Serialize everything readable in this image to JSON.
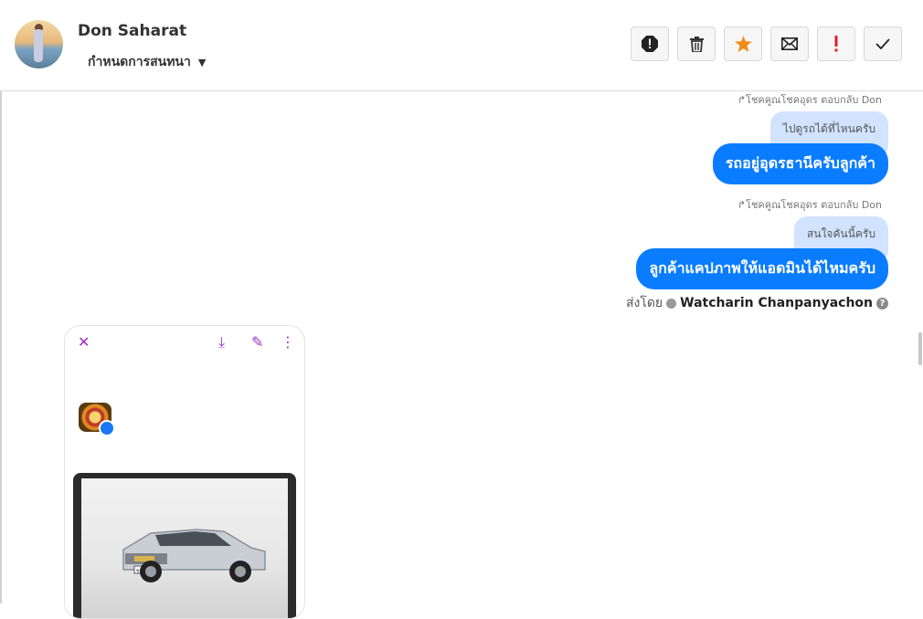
{
  "header": {
    "contact_name": "Don Saharat",
    "assign_label": "กำหนดการสนทนา",
    "toolbar": [
      {
        "name": "spam-button",
        "icon": "octagon-exclamation-icon"
      },
      {
        "name": "delete-button",
        "icon": "trash-icon"
      },
      {
        "name": "star-button",
        "icon": "star-icon",
        "color": "#f08c1a"
      },
      {
        "name": "mark-unread-button",
        "icon": "envelope-icon"
      },
      {
        "name": "follow-up-button",
        "icon": "exclamation-icon",
        "color": "#e02020"
      },
      {
        "name": "done-button",
        "icon": "check-icon"
      }
    ]
  },
  "messages": [
    {
      "reply_meta": "↱โชคคูณโชคอุดร ตอบกลับ Don",
      "quoted": "ไปดูรถได้ที่ไหนครับ",
      "text": "รถอยู่อุดรธานีครับลูกค้า"
    },
    {
      "reply_meta": "↱โชคคูณโชคอุดร ตอบกลับ Don",
      "quoted": "สนใจคันนี้ครับ",
      "text": "ลูกค้าแคปภาพให้แอดมินได้ไหมครับ"
    }
  ],
  "sent_by": {
    "label": "ส่งโดย",
    "name": "Watcharin Chanpanyachon",
    "help": "?"
  },
  "attachment": {
    "icons": [
      "close-icon",
      "download-icon",
      "edit-icon",
      "more-vertical-icon"
    ],
    "close": "✕",
    "download": "⤓",
    "edit": "✎",
    "more": "⋮",
    "plate_text": "ขต 4519"
  },
  "colors": {
    "bubble": "#0a7cff",
    "quoted": "#d1e3ff",
    "accent": "#9b2fc9"
  }
}
